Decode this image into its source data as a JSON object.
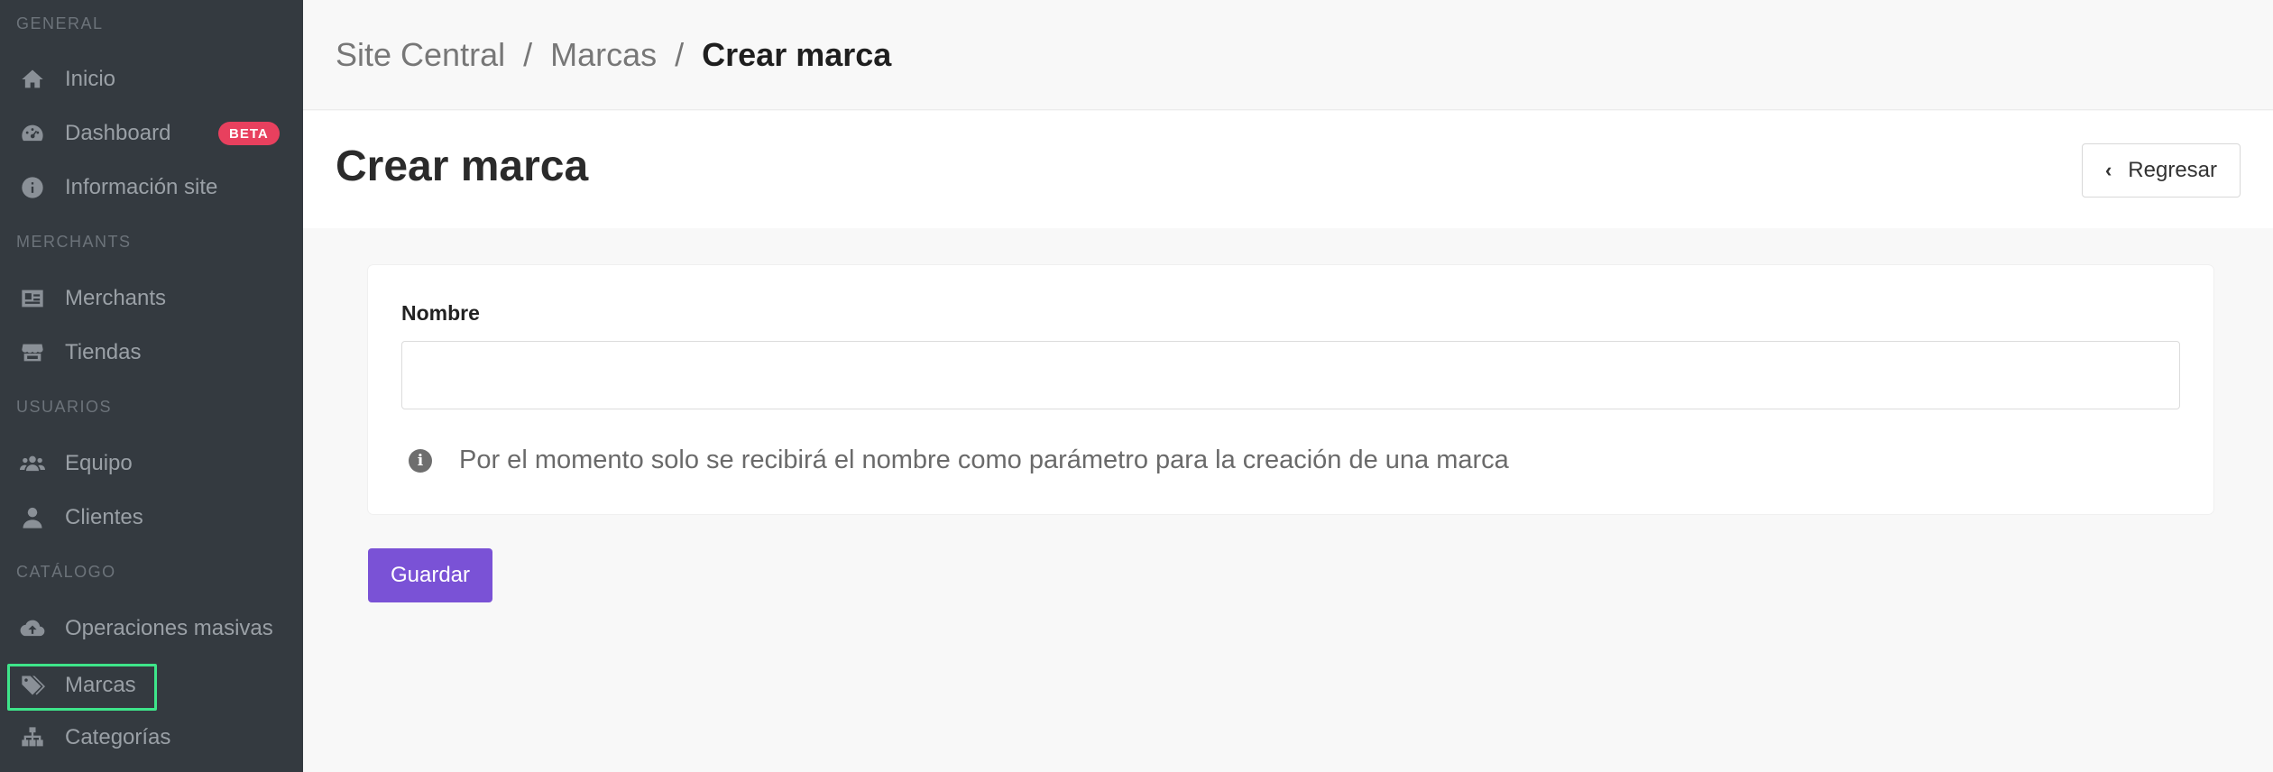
{
  "sidebar": {
    "sections": {
      "general": "GENERAL",
      "merchants": "MERCHANTS",
      "usuarios": "USUARIOS",
      "catalogo": "CATÁLOGO"
    },
    "items": {
      "inicio": "Inicio",
      "dashboard": "Dashboard",
      "dashboard_badge": "BETA",
      "info_site": "Información site",
      "merchants": "Merchants",
      "tiendas": "Tiendas",
      "equipo": "Equipo",
      "clientes": "Clientes",
      "operaciones": "Operaciones masivas",
      "marcas": "Marcas",
      "categorias": "Categorías"
    },
    "icons": {
      "inicio": "home-icon",
      "dashboard": "gauge-icon",
      "info_site": "info-circle-icon",
      "merchants": "id-card-icon",
      "tiendas": "store-icon",
      "equipo": "users-icon",
      "clientes": "user-icon",
      "operaciones": "cloud-upload-icon",
      "marcas": "tags-icon",
      "categorias": "sitemap-icon"
    }
  },
  "breadcrumb": {
    "root": "Site Central",
    "sep1": "/",
    "parent": "Marcas",
    "sep2": "/",
    "current": "Crear marca"
  },
  "page": {
    "title": "Crear marca",
    "back_label": "Regresar"
  },
  "form": {
    "name_label": "Nombre",
    "name_value": "",
    "hint_icon": "i",
    "hint": "Por el momento solo se recibirá el nombre como parámetro para la creación de una marca",
    "save_label": "Guardar"
  },
  "colors": {
    "sidebar_bg": "#343a40",
    "accent": "#7a52d6",
    "badge": "#e8405e",
    "highlight": "#3ee58a"
  }
}
